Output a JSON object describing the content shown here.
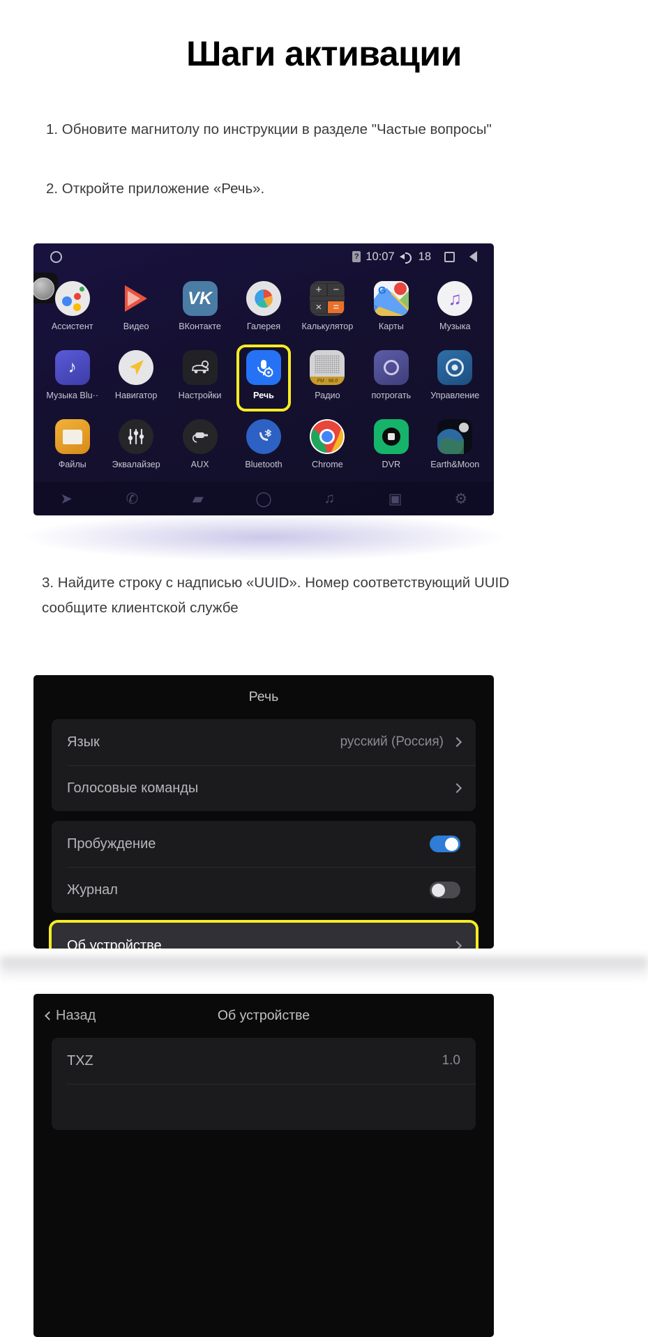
{
  "heading": "Шаги активации",
  "steps": [
    "1. Обновите магнитолу по инструкции в разделе \"Частые вопросы\"",
    "2. Откройте приложение «Речь».",
    "3. Найдите строку с надписью «UUID». Номер соответствующий UUID сообщите клиентской службе"
  ],
  "launcher": {
    "status_bar": {
      "home_ring_icon": "circle-outline-icon",
      "sim_icon": "sim-card-icon",
      "sim_label": "?",
      "time": "10:07",
      "volume_icon": "speaker-icon",
      "volume_level": "18",
      "square_icon": "recents-square-icon",
      "back_icon": "back-triangle-icon"
    },
    "rows": [
      [
        {
          "label": "Ассистент",
          "icon": "google-assistant-icon"
        },
        {
          "label": "Видео",
          "icon": "video-play-icon"
        },
        {
          "label": "ВКонтакте",
          "icon": "vk-icon"
        },
        {
          "label": "Галерея",
          "icon": "gallery-icon"
        },
        {
          "label": "Калькулятор",
          "icon": "calculator-icon"
        },
        {
          "label": "Карты",
          "icon": "google-maps-icon"
        },
        {
          "label": "Музыка",
          "icon": "music-note-icon"
        }
      ],
      [
        {
          "label": "Музыка Blu··",
          "icon": "bluetooth-music-icon"
        },
        {
          "label": "Навигатор",
          "icon": "navigator-arrow-icon"
        },
        {
          "label": "Настройки",
          "icon": "car-settings-icon"
        },
        {
          "label": "Речь",
          "icon": "microphone-settings-icon",
          "selected": true
        },
        {
          "label": "Радио",
          "icon": "radio-icon"
        },
        {
          "label": "потрогать",
          "icon": "touch-ring-icon"
        },
        {
          "label": "Управление",
          "icon": "steering-wheel-icon"
        }
      ],
      [
        {
          "label": "Файлы",
          "icon": "folder-icon"
        },
        {
          "label": "Эквалайзер",
          "icon": "equalizer-icon"
        },
        {
          "label": "AUX",
          "icon": "aux-plug-icon"
        },
        {
          "label": "Bluetooth",
          "icon": "bluetooth-phone-icon"
        },
        {
          "label": "Chrome",
          "icon": "chrome-icon"
        },
        {
          "label": "DVR",
          "icon": "dvr-camera-icon"
        },
        {
          "label": "Earth&Moon",
          "icon": "earth-moon-icon"
        }
      ]
    ],
    "navbar": [
      {
        "icon": "navigation-arrow-icon",
        "glyph": "➤"
      },
      {
        "icon": "phone-icon",
        "glyph": "✆"
      },
      {
        "icon": "radio-icon",
        "glyph": "▰"
      },
      {
        "icon": "home-circle-icon",
        "glyph": "◯"
      },
      {
        "icon": "music-note-icon",
        "glyph": "♫"
      },
      {
        "icon": "video-icon",
        "glyph": "▣"
      },
      {
        "icon": "gear-icon",
        "glyph": "⚙"
      }
    ]
  },
  "speech_screen": {
    "title": "Речь",
    "group1": [
      {
        "label": "Язык",
        "value": "русский (Россия)",
        "chevron": true
      },
      {
        "label": "Голосовые команды",
        "value": "",
        "chevron": true
      }
    ],
    "group2": [
      {
        "label": "Пробуждение",
        "toggle": "on"
      },
      {
        "label": "Журнал",
        "toggle": "off"
      }
    ],
    "highlighted_row": {
      "label": "Об устройстве",
      "chevron": true
    }
  },
  "about_screen": {
    "back_label": "Назад",
    "title": "Об устройстве",
    "rows": [
      {
        "label": "TXZ",
        "value": "1.0"
      }
    ]
  },
  "colors": {
    "highlight": "#f7ec23",
    "launcher_bg": "#151034",
    "panel_bg": "#0a0a0a",
    "toggle_on": "#2f7dd6"
  }
}
